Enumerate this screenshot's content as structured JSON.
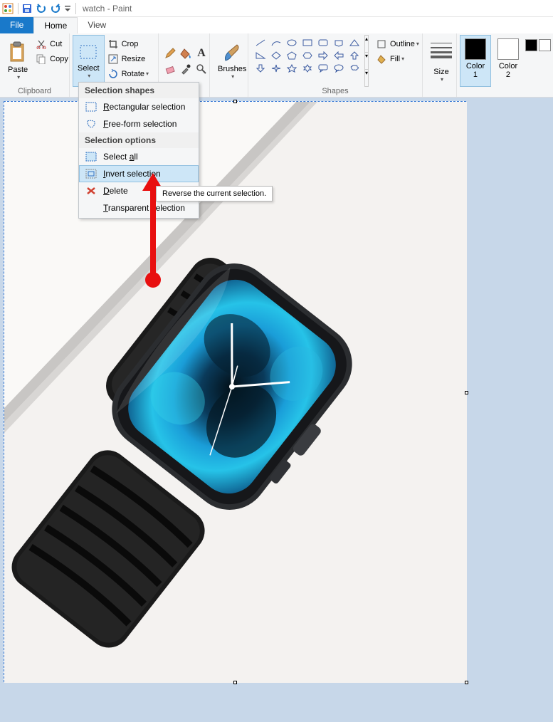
{
  "titlebar": {
    "document_name": "watch",
    "app_name": "Paint"
  },
  "tabs": {
    "file": "File",
    "home": "Home",
    "view": "View"
  },
  "ribbon": {
    "clipboard": {
      "label": "Clipboard",
      "paste": "Paste",
      "cut": "Cut",
      "copy": "Copy"
    },
    "image": {
      "select": "Select",
      "crop": "Crop",
      "resize": "Resize",
      "rotate": "Rotate"
    },
    "brushes": "Brushes",
    "shapes": {
      "label": "Shapes",
      "outline": "Outline",
      "fill": "Fill"
    },
    "size": "Size",
    "colors": {
      "color1": "Color\n1",
      "color2": "Color\n2",
      "color1_value": "#000000",
      "color2_value": "#ffffff"
    }
  },
  "menu": {
    "header1": "Selection shapes",
    "rect": "Rectangular selection",
    "free": "Free-form selection",
    "header2": "Selection options",
    "selectall": "Select all",
    "selectall_u": "a",
    "invert": "Invert selection",
    "invert_u": "I",
    "delete": "Delete",
    "delete_u": "D",
    "transparent": "Transparent selection",
    "transparent_u": "T"
  },
  "tooltip": "Reverse the current selection."
}
